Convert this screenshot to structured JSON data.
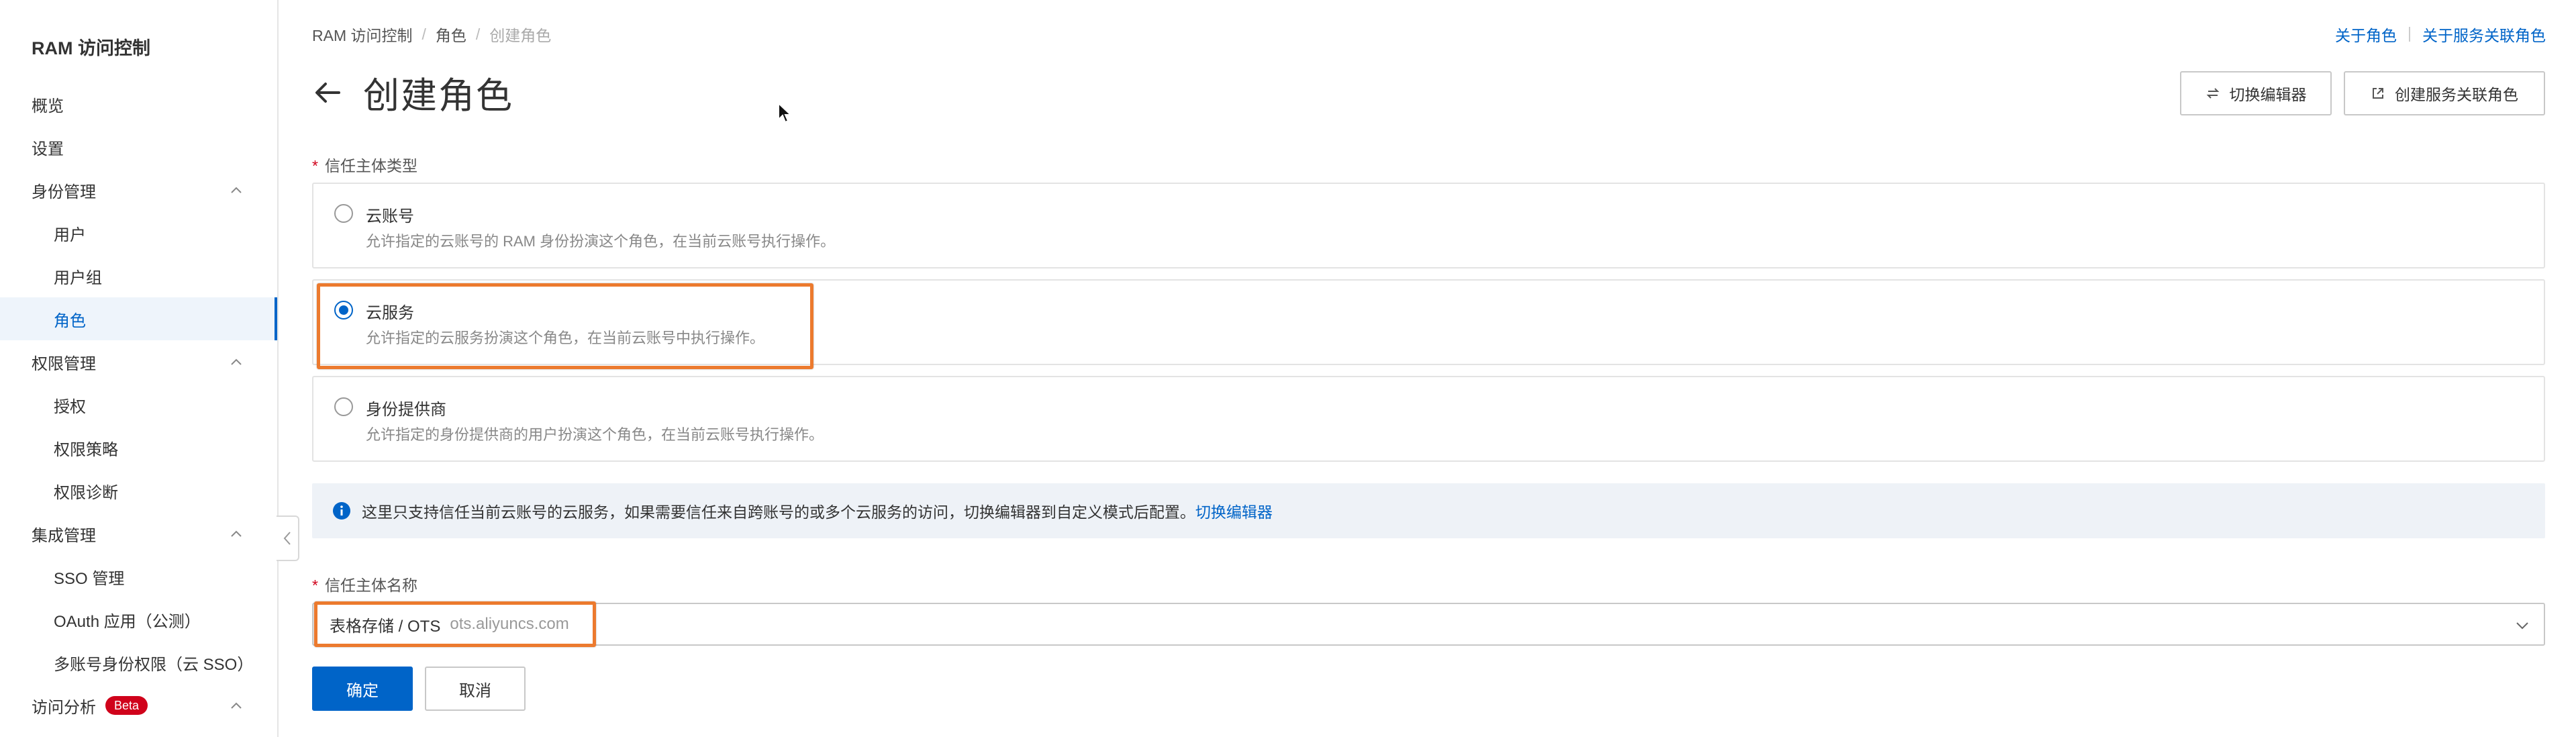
{
  "sidebar": {
    "title": "RAM 访问控制",
    "items": [
      {
        "label": "概览"
      },
      {
        "label": "设置"
      },
      {
        "label": "身份管理"
      },
      {
        "label": "用户"
      },
      {
        "label": "用户组"
      },
      {
        "label": "角色"
      },
      {
        "label": "权限管理"
      },
      {
        "label": "授权"
      },
      {
        "label": "权限策略"
      },
      {
        "label": "权限诊断"
      },
      {
        "label": "集成管理"
      },
      {
        "label": "SSO 管理"
      },
      {
        "label": "OAuth 应用（公测）"
      },
      {
        "label": "多账号身份权限（云 SSO）"
      },
      {
        "label": "访问分析",
        "badge": "Beta"
      }
    ]
  },
  "breadcrumb": [
    "RAM 访问控制",
    "角色",
    "创建角色"
  ],
  "top_links": [
    "关于角色",
    "关于服务关联角色"
  ],
  "page_title": "创建角色",
  "header_buttons": {
    "switch_editor": "切换编辑器",
    "create_linked_role": "创建服务关联角色"
  },
  "trust_type": {
    "label": "信任主体类型",
    "required_mark": "*",
    "selected": "云服务",
    "options": [
      {
        "title": "云账号",
        "desc": "允许指定的云账号的 RAM 身份扮演这个角色，在当前云账号执行操作。"
      },
      {
        "title": "云服务",
        "desc": "允许指定的云服务扮演这个角色，在当前云账号中执行操作。"
      },
      {
        "title": "身份提供商",
        "desc": "允许指定的身份提供商的用户扮演这个角色，在当前云账号执行操作。"
      }
    ]
  },
  "info": {
    "text": "这里只支持信任当前云账号的云服务，如果需要信任来自跨账号的或多个云服务的访问，切换编辑器到自定义模式后配置。",
    "link": "切换编辑器"
  },
  "trust_name": {
    "label": "信任主体名称",
    "required_mark": "*",
    "value": "表格存储 / OTS",
    "sub_value": "ots.aliyuncs.com"
  },
  "actions": {
    "confirm": "确定",
    "cancel": "取消"
  },
  "colors": {
    "primary": "#0064c8",
    "highlight": "#ec7a2e",
    "badge": "#d0021b"
  }
}
